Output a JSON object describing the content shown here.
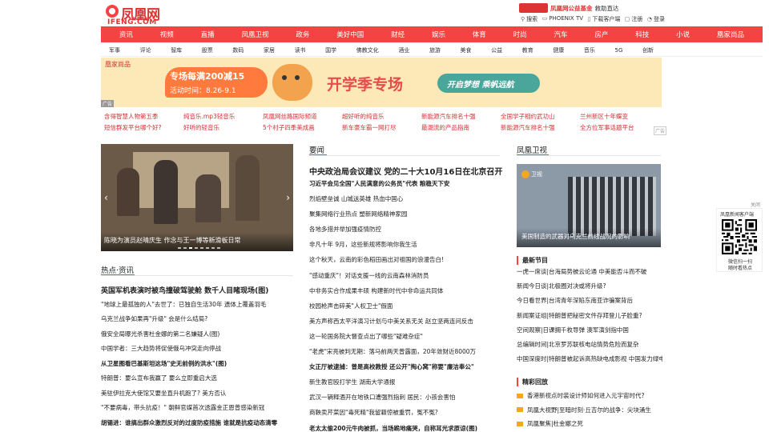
{
  "header": {
    "logo_text": "凤凰网",
    "logo_sub": "IFENG.COM",
    "top_ad_phoenix": "凤凰网公益基金",
    "top_ad_cta": "救助直达",
    "links": [
      "搜索",
      "PHOENIX TV",
      "下载客户端",
      "注册",
      "登录"
    ]
  },
  "nav": [
    "资讯",
    "视频",
    "直播",
    "凤凰卫视",
    "政务",
    "美好中国",
    "财经",
    "娱乐",
    "体育",
    "时尚",
    "汽车",
    "房产",
    "科技",
    "小说",
    "凰家尚品"
  ],
  "subnav": [
    "军事",
    "评论",
    "智库",
    "股票",
    "数码",
    "家居",
    "读书",
    "国学",
    "佛教文化",
    "酒业",
    "旅游",
    "美食",
    "公益",
    "教育",
    "健康",
    "音乐",
    "5G",
    "创新"
  ],
  "banner": {
    "label": "凰家尚品",
    "promo": "专场每满200减15",
    "date": "活动时间：8.26-9.1",
    "headline": "开学季专场",
    "slogan": "开启梦想 乘帆远航",
    "ad": "广告"
  },
  "ad_links": [
    [
      "含得智慧人物第五季",
      "纯音乐.mp3轻音乐",
      "凤凰网丝路国际频道",
      "超好听的纯音乐",
      "新能源汽车排名十强",
      "全国学子相约武功山",
      "兰州新区十年蝶变"
    ],
    [
      "短信群发平台哪个好?",
      "好听的轻音乐",
      "5个村子四季美成画",
      "新车豪车霸一网打尽",
      "最潮流的产品指南",
      "新能源汽车排名十强",
      "全方位军事话题平台"
    ]
  ],
  "ad_tag": "广告",
  "slider": {
    "caption": "陈晓为演员赵晴庆生 作念与王一博等新滑板日常",
    "prev": "‹",
    "next": "›"
  },
  "hot": {
    "title": "热点·资讯",
    "items": [
      "英国军机表演时被鸟撞破驾驶舱 数千人目睹现场(图)",
      "\"地球上最孤独的人\"去世了：已独自生活30年 遗体上覆盖羽毛",
      "乌克兰战争如果再\"升级\" 会是什么结局?",
      "俄安全局曝光杀害杜金娜的第二名嫌疑人(图)",
      "中国学者：三大趋势将促使俄乌冲突走向停战",
      "从卫星图看巴基斯坦这场\"史无前例的洪水\"(图)",
      "特朗普：要么宣布我赢了 要么立即重启大选",
      "美驻伊拉克大使馆又要坐直升机跑了? 美方否认",
      "\"不要病毒，带头抗疫！\" 朝鲜官媒首次透露金正恩曾感染新冠",
      "胡锡进：谁搞出群众激烈反对的过度防疫措施 谁就是抗疫动态清零"
    ]
  },
  "yaowen": {
    "title": "要闻",
    "top": "中央政治局会议建议 党的二十大10月16日在北京召开",
    "items": [
      "习近平会见全国\"人民满意的公务员\"代表  粮稳天下安",
      "烈焰壁垒诚  山城送英雄  热血中国心",
      "聚集网络行业热点 塑新网络精神家园",
      "各地多措并举加强疫情防控",
      "非凡十年  9月，这些新规将影响你我生活",
      "这个秋天，云南的彩色稻田画出对祖国的浪漫告白!",
      "\"感动重庆\"！对话支援一线的云南森林消防员",
      "中非务实合作成果丰硕 构建新时代中非命运共同体",
      "校园枪声击碎美\"人权卫士\"假面",
      "美方声称西太平洋演习计划与中美关系无关 赵立坚两连问反击",
      "这一轮国务院大督查点出了哪些\"疑难杂症\"",
      "\"老虎\"宋亮被判无期：落马前两天曾露面，20年敛财近8000万",
      "女正厅被逮捕：曾是高校教授 还公开\"掏心窝\"称要\"廉洁奉公\"",
      "新生教官殴打学生 湖南大学通报",
      "武汉一辆释酒开在地铁口遭强烈指刺 居民：小孩会害怕",
      "商鞅卖芹菜因\"毒死精\"我留籍惊被重罚，冤不冤?",
      "老太太偷200元牛肉被抓，当场跪地痛哭，自称耳光求原谅(图)"
    ]
  },
  "phoenix_tv": {
    "title": "凤凰卫视",
    "logo": "卫视",
    "caption": "美国制造的武器对乌克兰前线战况的影响"
  },
  "latest": {
    "title": "最新节目",
    "items": [
      "一虎一席谈|台海局势被云论通 中美能否斗而不破",
      "新闻今日谈|北极圈对决或将升级?",
      "今日看世界|台湾青年深陷东南亚诈骗案背后",
      "新闻案证组|特朗普把秘密文件存拜登儿子脸重?",
      "空间观察|日课拥千枚导弹 澳军演剑指中国",
      "总编辑时间|北京罗苏联核电站情势危险而复杂",
      "中国深度时|特朗普被起诉高热缺电成影视 中国发力绿电储能"
    ]
  },
  "highlights": {
    "title": "精彩回放",
    "items": [
      "香港新视点时装设计师如何进入元宇宙时代?",
      "凤凰大视野|至暗时刻·丘吉尔的战争：尖块涌生",
      "凤凰聚焦|杜金娜之死"
    ]
  },
  "qr": {
    "close": "关闭",
    "line1": "凤凰新闻客户端",
    "line2": "微信扫一扫",
    "line3": "随时看热点"
  },
  "colors": {
    "accent": "#f54343",
    "ad_link": "#cc3333"
  }
}
